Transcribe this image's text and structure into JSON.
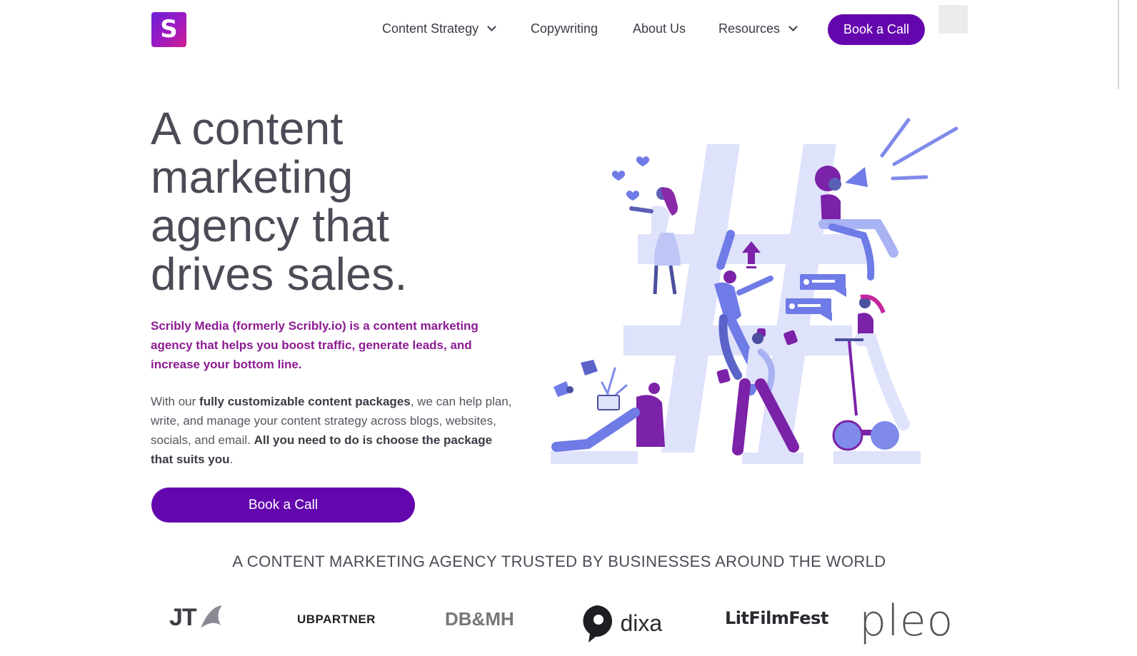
{
  "header": {
    "logo_letter": "S",
    "nav": [
      {
        "label": "Content Strategy",
        "has_dropdown": true
      },
      {
        "label": "Copywriting",
        "has_dropdown": false
      },
      {
        "label": "About Us",
        "has_dropdown": false
      },
      {
        "label": "Resources",
        "has_dropdown": true
      }
    ],
    "cta_label": "Book a Call"
  },
  "hero": {
    "title_lines": [
      "A content",
      "marketing",
      "agency that",
      "drives sales."
    ],
    "lead": "Scribly Media (formerly Scribly.io) is a content marketing agency that helps you boost traffic, generate leads, and increase your bottom line.",
    "body": {
      "part1": "With our ",
      "bold1": "fully customizable content packages",
      "part2": ", we can help plan, write, and manage your content strategy across blogs, websites, socials, and email. ",
      "bold2": "All you need to do is choose the package that suits you",
      "part3": "."
    },
    "cta_label": "Book a Call"
  },
  "trusted": {
    "heading": "A CONTENT MARKETING AGENCY TRUSTED BY BUSINESSES AROUND THE WORLD",
    "clients": [
      "JT",
      "UBPARTNER",
      "DB&MH",
      "dixa",
      "LitFilmFest",
      "pleo"
    ]
  },
  "colors": {
    "brand_purple": "#6406ad",
    "lead_text": "#8c1b93",
    "illustration_light": "#dfe2fb",
    "illustration_mid": "#6f7be6",
    "illustration_dark": "#7b22a8"
  }
}
